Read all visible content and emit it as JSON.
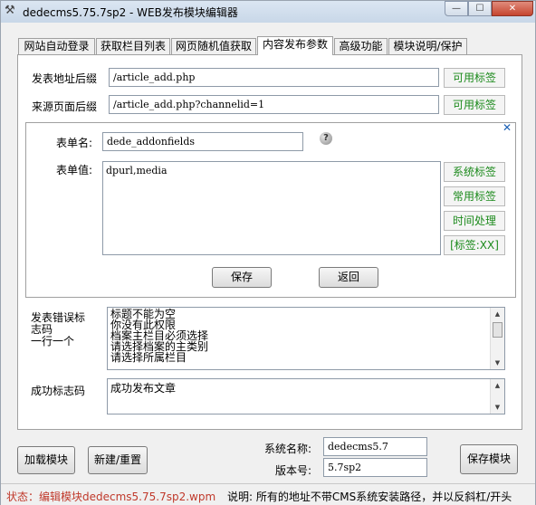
{
  "window": {
    "title": "dedecms5.75.7sp2 - WEB发布模块编辑器",
    "app_icon": "tools-icon",
    "min_glyph": "—",
    "max_glyph": "☐",
    "close_glyph": "✕"
  },
  "tabs": [
    {
      "label": "网站自动登录"
    },
    {
      "label": "获取栏目列表"
    },
    {
      "label": "网页随机值获取"
    },
    {
      "label": "内容发布参数",
      "active": true
    },
    {
      "label": "高级功能"
    },
    {
      "label": "模块说明/保护"
    }
  ],
  "publish": {
    "url_suffix_label": "发表地址后缀",
    "url_suffix_value": "/article_add.php",
    "source_suffix_label": "来源页面后缀",
    "source_suffix_value": "/article_add.php?channelid=1",
    "available_tags_button": "可用标签"
  },
  "form": {
    "close_glyph": "✕",
    "form_name_label": "表单名:",
    "form_name_value": "dede_addonfields",
    "help_glyph": "?",
    "form_value_label": "表单值:",
    "form_value_text": "dpurl,media",
    "system_tags_button": "系统标签",
    "common_tags_button": "常用标签",
    "time_process_button": "时间处理",
    "tag_xx_button": "[标签:XX]",
    "save_button": "保存",
    "back_button": "返回"
  },
  "error_codes": {
    "label_lines": [
      "发表错误标",
      "志码",
      "一行一个"
    ],
    "lines": [
      "标题不能为空",
      "你没有此权限",
      "档案主栏目必须选择",
      "请选择档案的主类别",
      "请选择所属栏目"
    ]
  },
  "success_codes": {
    "label": "成功标志码",
    "lines": [
      "成功发布文章"
    ]
  },
  "bottom": {
    "load_module_button": "加载模块",
    "new_reset_button": "新建/重置",
    "system_name_label": "系统名称:",
    "system_name_value": "dedecms5.7",
    "version_label": "版本号:",
    "version_value": "5.7sp2",
    "save_module_button": "保存模块"
  },
  "status": {
    "left": "状态：编辑模块dedecms5.75.7sp2.wpm",
    "right": "说明: 所有的地址不带CMS系统安装路径，并以反斜杠/开头"
  },
  "colors": {
    "tag_text": "#1c8a1c",
    "status_text": "#c0392b",
    "close_x": "#1a5fb4"
  }
}
